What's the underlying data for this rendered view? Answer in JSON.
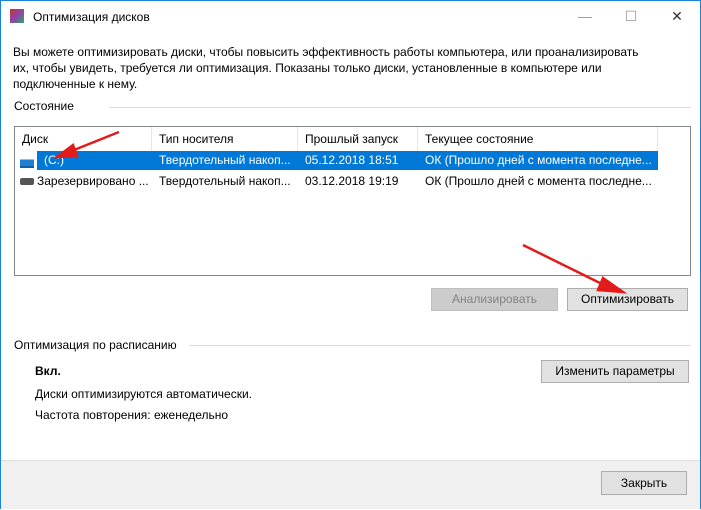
{
  "window": {
    "title": "Оптимизация дисков",
    "minimize": "—",
    "maximize": "☐",
    "close": "✕"
  },
  "intro": [
    "Вы можете оптимизировать диски, чтобы повысить эффективность работы  компьютера, или проанализировать",
    "их, чтобы увидеть, требуется ли оптимизация. Показаны только диски, установленные в компьютере или",
    "подключенные к нему."
  ],
  "status": {
    "label": "Состояние",
    "columns": [
      "Диск",
      "Тип носителя",
      "Прошлый запуск",
      "Текущее состояние"
    ],
    "rows": [
      {
        "disk": "(C:)",
        "type": "Твердотельный накоп...",
        "last": "05.12.2018 18:51",
        "state": "ОК (Прошло дней с момента последне...",
        "selected": true
      },
      {
        "disk": "Зарезервировано ...",
        "type": "Твердотельный накоп...",
        "last": "03.12.2018 19:19",
        "state": "ОК (Прошло дней с момента последне...",
        "selected": false
      }
    ]
  },
  "buttons": {
    "analyze": "Анализировать",
    "optimize": "Оптимизировать",
    "change": "Изменить параметры",
    "close": "Закрыть"
  },
  "schedule": {
    "label": "Оптимизация по расписанию",
    "state": "Вкл.",
    "auto": "Диски оптимизируются автоматически.",
    "freq": "Частота повторения: еженедельно"
  },
  "colors": {
    "accent": "#0078d7",
    "arrow": "#e21b1b"
  }
}
